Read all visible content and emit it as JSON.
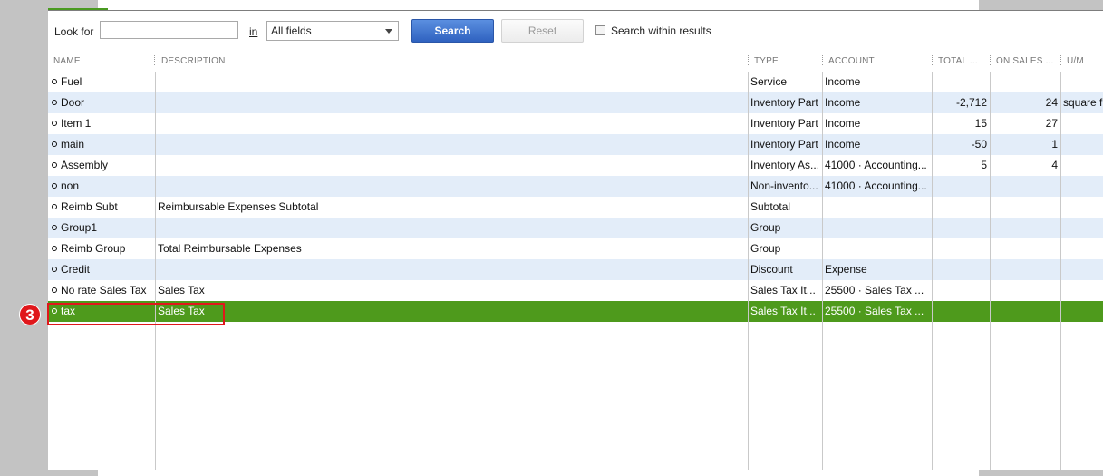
{
  "toolbar": {
    "look_for_label": "Look for",
    "look_for_value": "",
    "in_label": "in",
    "field_selected": "All fields",
    "search_label": "Search",
    "reset_label": "Reset",
    "search_within_label": "Search within results",
    "search_within_checked": false
  },
  "columns": [
    "NAME",
    "DESCRIPTION",
    "TYPE",
    "ACCOUNT",
    "TOTAL ...",
    "ON SALES ...",
    "U/M"
  ],
  "rows": [
    {
      "name": "Fuel",
      "description": "",
      "type": "Service",
      "account": "Income",
      "total": "",
      "on_sales": "",
      "um": ""
    },
    {
      "name": "Door",
      "description": "",
      "type": "Inventory Part",
      "account": "Income",
      "total": "-2,712",
      "on_sales": "24",
      "um": "square f"
    },
    {
      "name": "Item 1",
      "description": "",
      "type": "Inventory Part",
      "account": "Income",
      "total": "15",
      "on_sales": "27",
      "um": ""
    },
    {
      "name": "main",
      "description": "",
      "type": "Inventory Part",
      "account": "Income",
      "total": "-50",
      "on_sales": "1",
      "um": ""
    },
    {
      "name": "Assembly",
      "description": "",
      "type": "Inventory As...",
      "account": "41000 · Accounting...",
      "total": "5",
      "on_sales": "4",
      "um": ""
    },
    {
      "name": "non",
      "description": "",
      "type": "Non-invento...",
      "account": "41000 · Accounting...",
      "total": "",
      "on_sales": "",
      "um": ""
    },
    {
      "name": "Reimb Subt",
      "description": "Reimbursable Expenses Subtotal",
      "type": "Subtotal",
      "account": "",
      "total": "",
      "on_sales": "",
      "um": ""
    },
    {
      "name": "Group1",
      "description": "",
      "type": "Group",
      "account": "",
      "total": "",
      "on_sales": "",
      "um": ""
    },
    {
      "name": "Reimb Group",
      "description": "Total Reimbursable Expenses",
      "type": "Group",
      "account": "",
      "total": "",
      "on_sales": "",
      "um": ""
    },
    {
      "name": "Credit",
      "description": "",
      "type": "Discount",
      "account": "Expense",
      "total": "",
      "on_sales": "",
      "um": ""
    },
    {
      "name": "No rate Sales Tax",
      "description": "Sales Tax",
      "type": "Sales Tax It...",
      "account": "25500 · Sales Tax ...",
      "total": "",
      "on_sales": "",
      "um": ""
    },
    {
      "name": "tax",
      "description": "Sales Tax",
      "type": "Sales Tax It...",
      "account": "25500 · Sales Tax ...",
      "total": "",
      "on_sales": "",
      "um": ""
    }
  ],
  "selected_row": 11,
  "step_badge": "3",
  "colors": {
    "selected_row": "#4e9a1c",
    "alt_row": "#e3edf9",
    "highlight": "#e0171b",
    "search_button": "#2f62c0"
  },
  "icons": {
    "row_bullet": "diamond-bullet-icon",
    "dropdown": "chevron-down-icon"
  }
}
